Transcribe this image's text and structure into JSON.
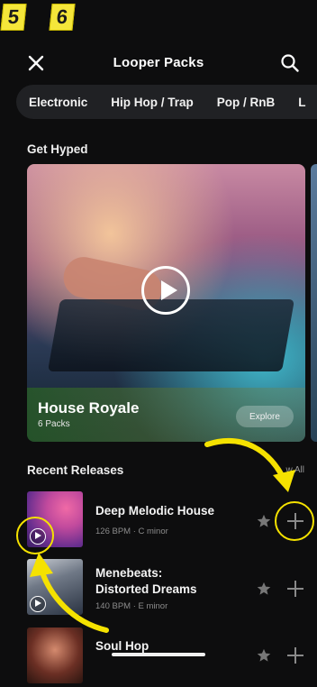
{
  "badges": [
    "5",
    "6"
  ],
  "header": {
    "title": "Looper Packs",
    "close_icon": "close-icon",
    "search_icon": "search-icon"
  },
  "genres": [
    "Electronic",
    "Hip Hop / Trap",
    "Pop / RnB",
    "L"
  ],
  "sections": {
    "get_hyped": "Get Hyped",
    "recent_releases": "Recent Releases",
    "view_all": "w All"
  },
  "hero": {
    "name": "House Royale",
    "count": "6 Packs",
    "explore_label": "Explore"
  },
  "releases": [
    {
      "title": "Deep Melodic House",
      "meta": "126 BPM · C minor"
    },
    {
      "title_line1": "Menebeats:",
      "title_line2": "Distorted Dreams",
      "meta": "140 BPM · E minor"
    },
    {
      "title": "Soul Hop"
    }
  ],
  "colors": {
    "background": "#0d0d0e",
    "highlight": "#f5e200",
    "chip_bg": "#202124"
  }
}
